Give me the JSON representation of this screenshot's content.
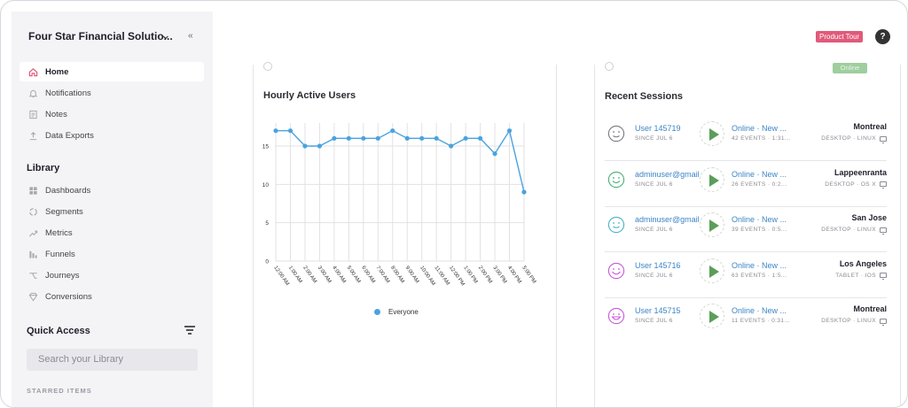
{
  "sidebar": {
    "org_name": "Four Star Financial Solutio...",
    "nav": [
      {
        "label": "Home",
        "icon": "home-icon",
        "active": true
      },
      {
        "label": "Notifications",
        "icon": "bell-icon"
      },
      {
        "label": "Notes",
        "icon": "note-icon"
      },
      {
        "label": "Data Exports",
        "icon": "export-icon"
      }
    ],
    "library_title": "Library",
    "library": [
      {
        "label": "Dashboards",
        "icon": "dashboard-icon"
      },
      {
        "label": "Segments",
        "icon": "segment-icon"
      },
      {
        "label": "Metrics",
        "icon": "metrics-icon"
      },
      {
        "label": "Funnels",
        "icon": "funnel-icon"
      },
      {
        "label": "Journeys",
        "icon": "journey-icon"
      },
      {
        "label": "Conversions",
        "icon": "conversion-icon"
      }
    ],
    "quick_access_title": "Quick Access",
    "search_placeholder": "Search your Library",
    "starred_title": "STARRED ITEMS"
  },
  "header": {
    "product_tour": "Product Tour",
    "help": "?"
  },
  "top_right_status": "Online",
  "chart_panel": {
    "title": "Hourly Active Users"
  },
  "chart_data": {
    "type": "line",
    "title": "Hourly Active Users",
    "categories": [
      "12:00 AM",
      "1:00 AM",
      "2:00 AM",
      "3:00 AM",
      "4:00 AM",
      "5:00 AM",
      "6:00 AM",
      "7:00 AM",
      "8:00 AM",
      "9:00 AM",
      "10:00 AM",
      "11:00 AM",
      "12:00 PM",
      "1:00 PM",
      "2:00 PM",
      "3:00 PM",
      "4:00 PM",
      "5:00 PM"
    ],
    "series": [
      {
        "name": "Everyone",
        "color": "#4aa3df",
        "values": [
          17,
          17,
          15,
          15,
          16,
          16,
          16,
          16,
          17,
          16,
          16,
          16,
          15,
          16,
          16,
          14,
          17,
          9
        ]
      }
    ],
    "yticks": [
      0,
      5,
      10,
      15
    ],
    "ylim": [
      0,
      18
    ],
    "legend": "bottom-center",
    "grid": true
  },
  "sessions": {
    "title": "Recent Sessions",
    "rows": [
      {
        "user": "User 145719",
        "since": "SINCE JUL 6",
        "status": "Online · New ...",
        "events": "42 EVENTS · 1:31...",
        "city": "Montreal",
        "os": "DESKTOP · LINUX",
        "face_color": "#7a7a82",
        "face": "wink-face-icon"
      },
      {
        "user": "adminuser@gmail.com",
        "since": "SINCE JUL 6",
        "status": "Online · New ...",
        "events": "26 EVENTS · 0:2...",
        "city": "Lappeenranta",
        "os": "DESKTOP · OS X",
        "face_color": "#4caf7a",
        "face": "smile-face-icon"
      },
      {
        "user": "adminuser@gmail.com",
        "since": "SINCE JUL 6",
        "status": "Online · New ...",
        "events": "39 EVENTS · 0:5...",
        "city": "San Jose",
        "os": "DESKTOP · LINUX",
        "face_color": "#4ab3c8",
        "face": "content-face-icon"
      },
      {
        "user": "User 145716",
        "since": "SINCE JUL 6",
        "status": "Online · New ...",
        "events": "63 EVENTS · 1:5...",
        "city": "Los Angeles",
        "os": "TABLET · IOS",
        "face_color": "#c85ad8",
        "face": "happy-face-icon"
      },
      {
        "user": "User 145715",
        "since": "SINCE JUL 6",
        "status": "Online · New ...",
        "events": "11 EVENTS · 0:31...",
        "city": "Montreal",
        "os": "DESKTOP · LINUX",
        "face_color": "#c85ad8",
        "face": "grin-face-icon"
      }
    ]
  }
}
